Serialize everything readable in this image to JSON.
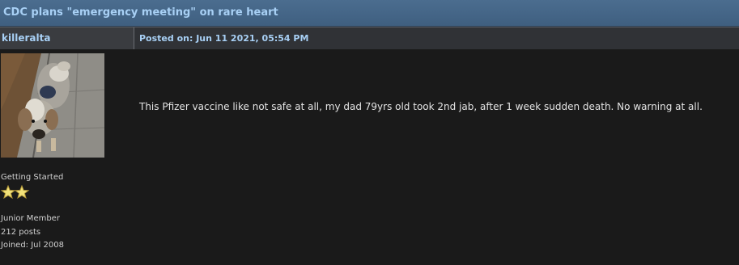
{
  "thread": {
    "title": "CDC plans \"emergency meeting\" on rare heart"
  },
  "post": {
    "author": "killeralta",
    "posted_on": "Posted on: Jun 11 2021, 05:54 PM",
    "body": "This Pfizer vaccine like not safe at all, my dad 79yrs old took 2nd jab, after 1 week sudden death. No warning at all."
  },
  "user": {
    "title": "Getting Started",
    "stars": 2,
    "rank": "Junior Member",
    "posts": "212 posts",
    "joined": "Joined: Jul 2008",
    "avatar_icon": "dog-photo"
  },
  "colors": {
    "link": "#a8d0f5",
    "header_bg": "#4b6d8f",
    "body_bg": "#1a1a1a",
    "star": "#f2e27a"
  }
}
